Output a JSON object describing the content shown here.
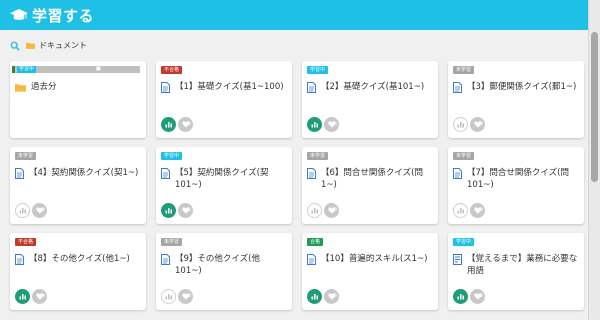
{
  "header": {
    "title": "学習する"
  },
  "breadcrumb": {
    "label": "ドキュメント"
  },
  "folder_card": {
    "title": "過去分",
    "tag": "学習中"
  },
  "cards": [
    {
      "title": "【1】基礎クイズ(基1~100)",
      "tag": "不合格",
      "tag_color": "red",
      "stats_active": true,
      "fav_count": "0"
    },
    {
      "title": "【2】基礎クイズ(基101~)",
      "tag": "学習中",
      "tag_color": "cyan",
      "stats_active": true,
      "fav_count": "0"
    },
    {
      "title": "【3】郵便関係クイズ(郵1~)",
      "tag": "未学習",
      "tag_color": "gray",
      "stats_active": false,
      "fav_count": "0"
    },
    {
      "title": "【4】契約関係クイズ(契1~)",
      "tag": "未学習",
      "tag_color": "gray",
      "stats_active": false,
      "fav_count": "0"
    },
    {
      "title": "【5】契約関係クイズ(契101~)",
      "tag": "学習中",
      "tag_color": "cyan",
      "stats_active": true,
      "fav_count": "0"
    },
    {
      "title": "【6】問合せ関係クイズ(問1~)",
      "tag": "未学習",
      "tag_color": "gray",
      "stats_active": false,
      "fav_count": "0"
    },
    {
      "title": "【7】問合せ関係クイズ(問101~)",
      "tag": "未学習",
      "tag_color": "gray",
      "stats_active": false,
      "fav_count": "0"
    },
    {
      "title": "【8】その他クイズ(他1~)",
      "tag": "不合格",
      "tag_color": "red",
      "stats_active": true,
      "fav_count": "0"
    },
    {
      "title": "【9】その他クイズ(他101~)",
      "tag": "未学習",
      "tag_color": "gray",
      "stats_active": false,
      "fav_count": "0"
    },
    {
      "title": "【10】普遍的スキル(ス1~)",
      "tag": "合格",
      "tag_color": "green",
      "stats_active": true,
      "fav_count": "0"
    },
    {
      "title": "【覚えるまで】業務に必要な用語",
      "tag": "学習中",
      "tag_color": "cyan",
      "stats_active": true,
      "fav_count": "0"
    }
  ],
  "colors": {
    "header": "#1ec0e6",
    "stats_on": "#1f9d79"
  }
}
